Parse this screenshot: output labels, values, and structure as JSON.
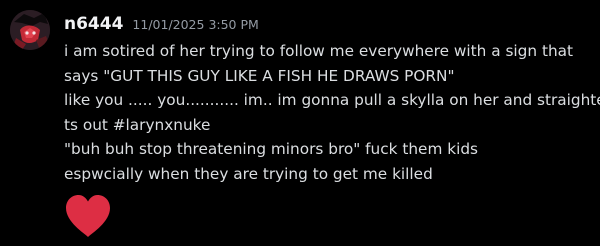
{
  "message": {
    "author": "n6444",
    "timestamp": "11/01/2025 3:50 PM",
    "lines": [
      "i am sotired of her trying to follow me everywhere with a sign that",
      "says \"GUT THIS GUY LIKE A FISH HE DRAWS PORN\"",
      "like you ..... you........... im.. im gonna pull a skylla on her and straighten",
      "ts out #larynxnuke",
      "\"buh buh stop threatening minors bro\" fuck them kids",
      "espwcially when they are trying to get me killed"
    ],
    "emoji": "heart-icon"
  },
  "colors": {
    "background": "#000000",
    "username": "#f2f3f5",
    "timestamp": "#949ba4",
    "text": "#dbdee1",
    "heart": "#dd2e44"
  }
}
